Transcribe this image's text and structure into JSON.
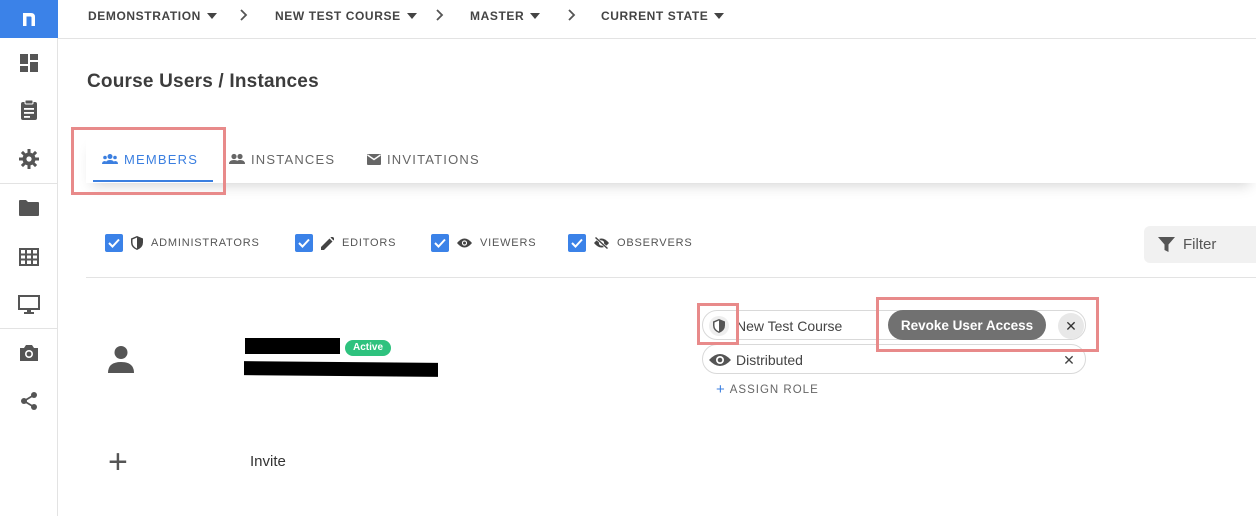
{
  "breadcrumbs": [
    {
      "label": "DEMONSTRATION"
    },
    {
      "label": "NEW TEST COURSE"
    },
    {
      "label": "MASTER"
    },
    {
      "label": "CURRENT STATE"
    }
  ],
  "page": {
    "title": "Course Users / Instances"
  },
  "tabs": [
    {
      "label": "MEMBERS",
      "icon": "group-icon",
      "active": true
    },
    {
      "label": "INSTANCES",
      "icon": "people-icon",
      "active": false
    },
    {
      "label": "INVITATIONS",
      "icon": "mail-icon",
      "active": false
    }
  ],
  "role_filters": [
    {
      "label": "ADMINISTRATORS",
      "icon": "shield-icon",
      "checked": true
    },
    {
      "label": "EDITORS",
      "icon": "pencil-icon",
      "checked": true
    },
    {
      "label": "VIEWERS",
      "icon": "eye-icon",
      "checked": true
    },
    {
      "label": "OBSERVERS",
      "icon": "eye-off-icon",
      "checked": true
    }
  ],
  "filter": {
    "label": "Filter"
  },
  "member": {
    "status": "Active",
    "roles": [
      {
        "label": "New Test Course",
        "icon": "shield-icon"
      },
      {
        "label": "Distributed",
        "icon": "eye-icon"
      }
    ],
    "revoke_label": "Revoke User Access",
    "assign_role_label": "ASSIGN ROLE"
  },
  "invite": {
    "label": "Invite"
  },
  "colors": {
    "accent": "#3b82e8",
    "active_badge": "#2ec27e",
    "highlight": "#e88a8a"
  }
}
